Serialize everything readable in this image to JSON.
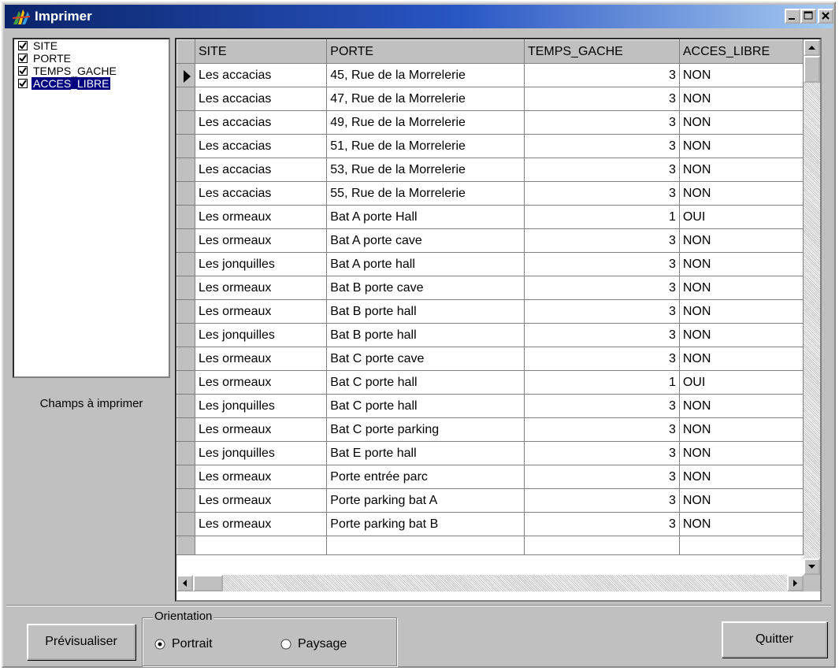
{
  "window": {
    "title": "Imprimer",
    "controls": [
      "minimize-icon",
      "maximize-icon",
      "close-icon"
    ]
  },
  "fields": {
    "items": [
      {
        "label": "SITE",
        "checked": true,
        "selected": false
      },
      {
        "label": "PORTE",
        "checked": true,
        "selected": false
      },
      {
        "label": "TEMPS_GACHE",
        "checked": true,
        "selected": false
      },
      {
        "label": "ACCES_LIBRE",
        "checked": true,
        "selected": true
      }
    ],
    "caption": "Champs à imprimer"
  },
  "grid": {
    "columns": [
      "SITE",
      "PORTE",
      "TEMPS_GACHE",
      "ACCES_LIBRE"
    ],
    "current_row": 0,
    "rows": [
      [
        "Les accacias",
        "45, Rue de la Morrelerie",
        "3",
        "NON"
      ],
      [
        "Les accacias",
        "47, Rue de la Morrelerie",
        "3",
        "NON"
      ],
      [
        "Les accacias",
        "49, Rue de la Morrelerie",
        "3",
        "NON"
      ],
      [
        "Les accacias",
        "51, Rue de la Morrelerie",
        "3",
        "NON"
      ],
      [
        "Les accacias",
        "53, Rue de la Morrelerie",
        "3",
        "NON"
      ],
      [
        "Les accacias",
        "55, Rue de la Morrelerie",
        "3",
        "NON"
      ],
      [
        "Les ormeaux",
        "Bat A porte Hall",
        "1",
        "OUI"
      ],
      [
        "Les ormeaux",
        "Bat A porte cave",
        "3",
        "NON"
      ],
      [
        "Les jonquilles",
        "Bat A porte hall",
        "3",
        "NON"
      ],
      [
        "Les ormeaux",
        "Bat B porte cave",
        "3",
        "NON"
      ],
      [
        "Les ormeaux",
        "Bat B porte hall",
        "3",
        "NON"
      ],
      [
        "Les jonquilles",
        "Bat B porte hall",
        "3",
        "NON"
      ],
      [
        "Les ormeaux",
        "Bat C porte cave",
        "3",
        "NON"
      ],
      [
        "Les ormeaux",
        "Bat C porte hall",
        "1",
        "OUI"
      ],
      [
        "Les jonquilles",
        "Bat C porte hall",
        "3",
        "NON"
      ],
      [
        "Les ormeaux",
        "Bat C porte parking",
        "3",
        "NON"
      ],
      [
        "Les jonquilles",
        "Bat E porte hall",
        "3",
        "NON"
      ],
      [
        "Les ormeaux",
        "Porte entrée parc",
        "3",
        "NON"
      ],
      [
        "Les ormeaux",
        "Porte parking bat A",
        "3",
        "NON"
      ],
      [
        "Les ormeaux",
        "Porte parking bat B",
        "3",
        "NON"
      ]
    ]
  },
  "footer": {
    "preview_button": "Prévisualiser",
    "orientation_title": "Orientation",
    "orientation_options": [
      {
        "label": "Portrait",
        "selected": true
      },
      {
        "label": "Paysage",
        "selected": false
      }
    ],
    "quit_button": "Quitter"
  },
  "colors": {
    "title_start": "#0a246a",
    "title_end": "#a6caf0",
    "face": "#c0c0c0",
    "selection": "#000080"
  }
}
